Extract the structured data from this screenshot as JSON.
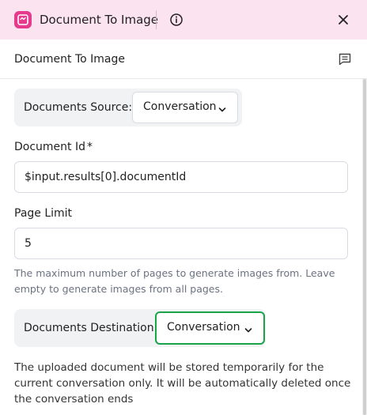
{
  "header": {
    "title": "Document To Image"
  },
  "subbar": {
    "title": "Document To Image"
  },
  "documents_source": {
    "label": "Documents Source:",
    "value": "Conversation"
  },
  "document_id": {
    "label": "Document Id",
    "required_mark": "*",
    "value": "$input.results[0].documentId"
  },
  "page_limit": {
    "label": "Page Limit",
    "value": "5",
    "help": "The maximum number of pages to generate images from. Leave empty to generate images from all pages."
  },
  "documents_destination": {
    "label": "Documents Destination:",
    "value": "Conversation"
  },
  "note": "The uploaded document will be stored temporarily for the current conversation only. It will be automatically deleted once the conversation ends",
  "colors": {
    "accent": "#e63b8c",
    "header_bg": "#fbe3ef",
    "active_border": "#1aa34a"
  },
  "icons": {
    "app": "document-image-icon",
    "info": "info-icon",
    "close": "close-icon",
    "notes": "notes-icon",
    "chevron": "chevron-down-icon"
  }
}
